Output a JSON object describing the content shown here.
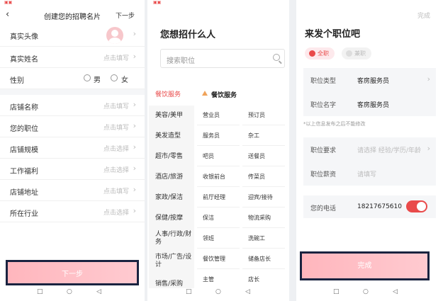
{
  "screen1": {
    "header": {
      "title": "创建您的招聘名片",
      "next": "下一步"
    },
    "fields": [
      {
        "label": "真实头像",
        "hint": ""
      },
      {
        "label": "真实姓名",
        "hint": "点击填写"
      },
      {
        "label": "性别",
        "hint": ""
      },
      {
        "label": "店铺名称",
        "hint": "点击填写"
      },
      {
        "label": "您的职位",
        "hint": "点击填写"
      },
      {
        "label": "店铺规模",
        "hint": "点击选择"
      },
      {
        "label": "工作福利",
        "hint": "点击选择"
      },
      {
        "label": "店铺地址",
        "hint": "点击填写"
      },
      {
        "label": "所在行业",
        "hint": "点击选择"
      }
    ],
    "gender_male": "男",
    "gender_female": "女",
    "cta": "下一步"
  },
  "screen2": {
    "title": "您想招什么人",
    "search_placeholder": "搜索职位",
    "selected_category": "餐饮服务",
    "categories": [
      "餐饮服务",
      "美容/美甲",
      "美发造型",
      "超市/零售",
      "酒店/旅游",
      "家政/保洁",
      "保健/按摩",
      "人事/行政/财务",
      "市场/广告/设计",
      "销售/采购"
    ],
    "positions": [
      "营业员",
      "预订员",
      "服务员",
      "杂工",
      "吧员",
      "送餐员",
      "收银前台",
      "传菜员",
      "前厅经理",
      "迎宾/接待",
      "保洁",
      "物流采购",
      "领班",
      "洗碗工",
      "餐饮管理",
      "储备店长",
      "主管",
      "店长"
    ]
  },
  "screen3": {
    "done_top": "完成",
    "title": "来发个职位吧",
    "tag_fulltime": "全职",
    "tag_parttime": "兼职",
    "job_type_label": "职位类型",
    "job_type_value": "客房服务员",
    "job_name_label": "职位名字",
    "job_name_value": "客房服务员",
    "note": "*以上信息发布之后不能修改",
    "requirement_label": "职位要求",
    "requirement_hint": "请选择 经验/学历/年龄",
    "salary_label": "职位薪资",
    "salary_hint": "请填写",
    "phone_label": "您的电话",
    "phone_value": "18217675610",
    "cta": "完成"
  },
  "icons": [
    "back-arrow-icon",
    "chevron-right-icon",
    "search-icon",
    "radio-icon",
    "toggle-icon",
    "nav-square-icon",
    "nav-circle-icon",
    "nav-back-icon"
  ],
  "colors": {
    "accent": "#e94a4a",
    "cta": "#ffbac1",
    "border": "#1a2340"
  }
}
